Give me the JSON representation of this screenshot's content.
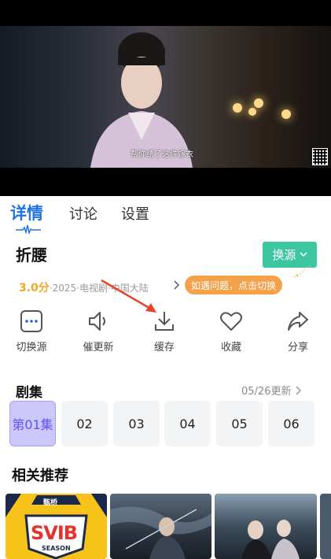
{
  "video": {
    "subtitle": "帮你绣了这件嫁衣"
  },
  "tabs": [
    {
      "label": "详情",
      "active": true
    },
    {
      "label": "讨论",
      "active": false
    },
    {
      "label": "设置",
      "active": false
    }
  ],
  "show": {
    "title": "折腰",
    "score": "3.0分",
    "meta": "·2025·电视剧·中国大陆",
    "switch_source_label": "换源",
    "hint": "如遇问题，点击切换"
  },
  "actions": [
    {
      "label": "切换源",
      "icon": "switch-source-icon"
    },
    {
      "label": "催更新",
      "icon": "speaker-icon"
    },
    {
      "label": "缓存",
      "icon": "download-icon"
    },
    {
      "label": "收藏",
      "icon": "heart-icon"
    },
    {
      "label": "分享",
      "icon": "share-icon"
    }
  ],
  "episodes": {
    "heading": "剧集",
    "update": "05/26更新",
    "items": [
      "第01集",
      "02",
      "03",
      "04",
      "05",
      "06"
    ],
    "selected": 0
  },
  "recommendations": {
    "heading": "相关推荐",
    "posters": [
      {
        "badge": "甄桥",
        "title": "SVIB",
        "caption": "SEASON"
      }
    ]
  },
  "colors": {
    "accent_blue": "#1f73e6",
    "switch_green": "#3cc7a0",
    "hint_orange": "#f5a14a",
    "score_orange": "#f5a623",
    "episode_active": "#5d52f5",
    "arrow_red": "#e8432f"
  }
}
